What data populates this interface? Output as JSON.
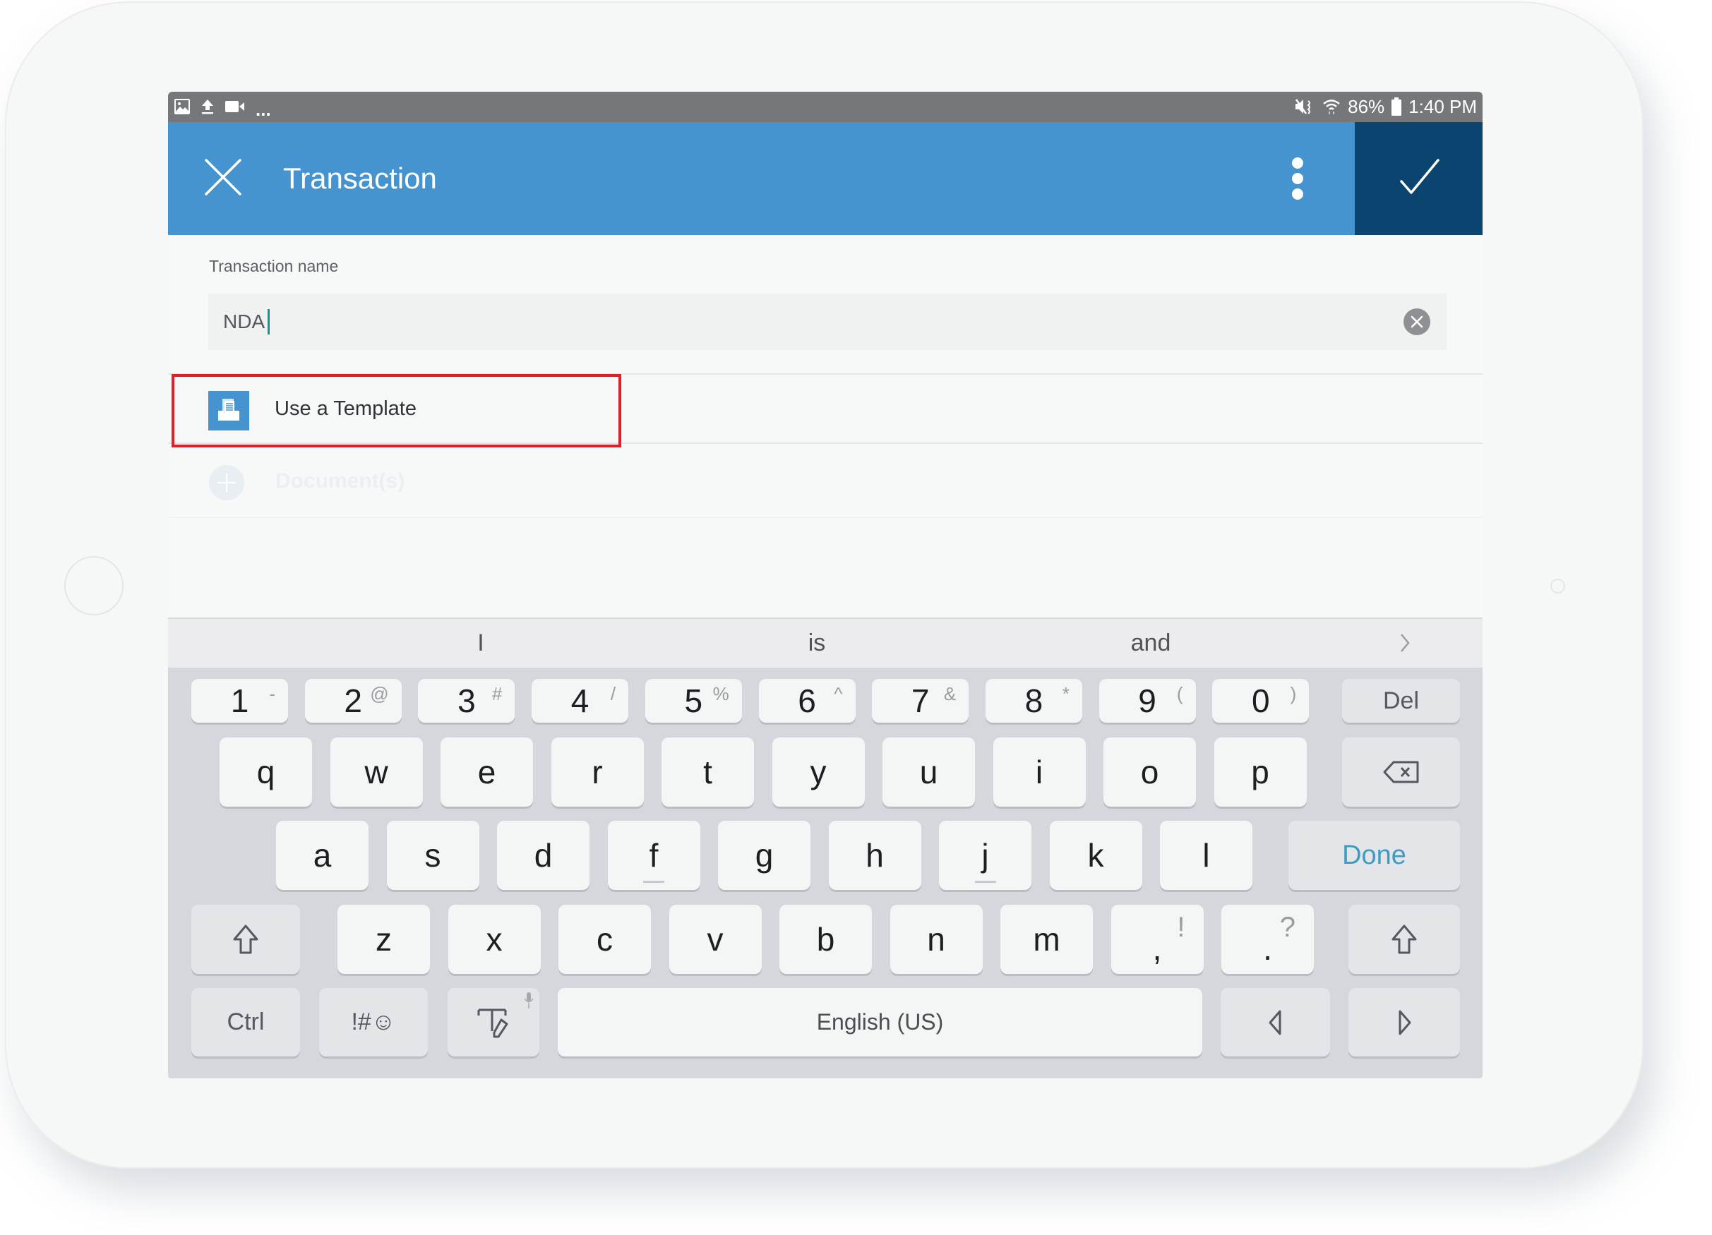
{
  "status_bar": {
    "left_icons": [
      "image-icon",
      "upload-icon",
      "video-camera-icon",
      "more-notifications-icon"
    ],
    "more_notifications": "...",
    "right_icons": [
      "mute-vibrate-icon",
      "wifi-icon"
    ],
    "battery_percent": "86%",
    "time": "1:40 PM"
  },
  "app_bar": {
    "title": "Transaction",
    "close_icon": "close-icon",
    "more_icon": "more-vertical-icon",
    "confirm_icon": "check-icon",
    "colors": {
      "primary": "#4694cf",
      "confirm_bg": "#0c4470"
    }
  },
  "form": {
    "name_label": "Transaction name",
    "name_value": "NDA",
    "clear_icon": "clear-circle-icon",
    "template_option": {
      "label": "Use a Template",
      "icon": "template-icon"
    },
    "documents_option": {
      "label": "Document(s)",
      "icon": "add-circle-icon"
    },
    "highlight_color": "#e41e26"
  },
  "keyboard": {
    "suggestions": [
      "I",
      "is",
      "and"
    ],
    "next_icon": "chevron-right-icon",
    "number_row": [
      {
        "main": "1",
        "sub": "-"
      },
      {
        "main": "2",
        "sub": "@"
      },
      {
        "main": "3",
        "sub": "#"
      },
      {
        "main": "4",
        "sub": "/"
      },
      {
        "main": "5",
        "sub": "%"
      },
      {
        "main": "6",
        "sub": "^"
      },
      {
        "main": "7",
        "sub": "&"
      },
      {
        "main": "8",
        "sub": "*"
      },
      {
        "main": "9",
        "sub": "("
      },
      {
        "main": "0",
        "sub": ")"
      }
    ],
    "del_label": "Del",
    "row1": [
      "q",
      "w",
      "e",
      "r",
      "t",
      "y",
      "u",
      "i",
      "o",
      "p"
    ],
    "backspace_icon": "backspace-icon",
    "row2": [
      "a",
      "s",
      "d",
      "f",
      "g",
      "h",
      "j",
      "k",
      "l"
    ],
    "done_label": "Done",
    "row3": [
      "z",
      "x",
      "c",
      "v",
      "b",
      "n",
      "m"
    ],
    "comma": {
      "main": ",",
      "sub": "!"
    },
    "period": {
      "main": ".",
      "sub": "?"
    },
    "shift_icon": "shift-icon",
    "ctrl_label": "Ctrl",
    "symbols_label": "!#☺",
    "handwriting_icon": "handwriting-icon",
    "mic_icon": "microphone-icon",
    "space_label": "English (US)",
    "cursor_left_icon": "cursor-left-icon",
    "cursor_right_icon": "cursor-right-icon",
    "done_color": "#3f9bc0"
  }
}
